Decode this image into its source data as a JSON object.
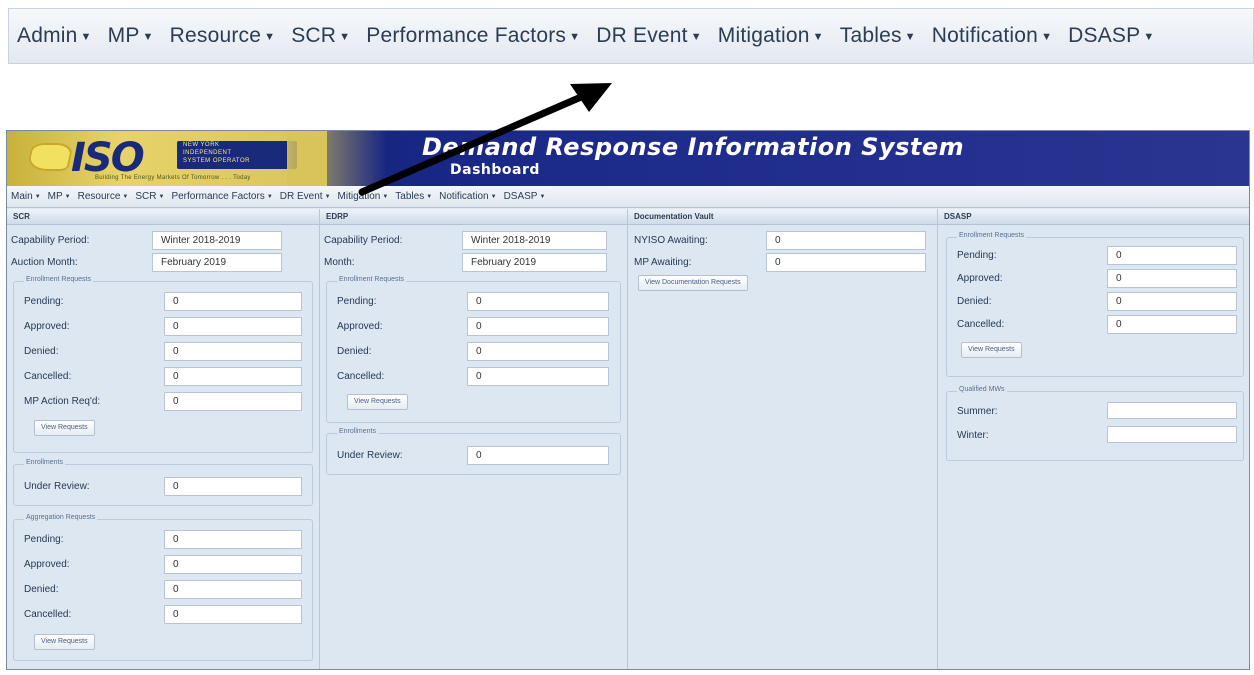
{
  "zoomed_menu": [
    {
      "label": "Admin"
    },
    {
      "label": "MP"
    },
    {
      "label": "Resource"
    },
    {
      "label": "SCR"
    },
    {
      "label": "Performance Factors"
    },
    {
      "label": "DR Event"
    },
    {
      "label": "Mitigation"
    },
    {
      "label": "Tables"
    },
    {
      "label": "Notification"
    },
    {
      "label": "DSASP"
    }
  ],
  "window": {
    "title": "Demand Response Information System",
    "subtitle": "Dashboard",
    "logo": {
      "text": "ISO",
      "org_lines": [
        "NEW YORK",
        "INDEPENDENT",
        "SYSTEM OPERATOR"
      ],
      "tagline": "Building The Energy Markets Of Tomorrow . . . Today"
    }
  },
  "menu": [
    {
      "label": "Main"
    },
    {
      "label": "MP"
    },
    {
      "label": "Resource"
    },
    {
      "label": "SCR"
    },
    {
      "label": "Performance Factors"
    },
    {
      "label": "DR Event"
    },
    {
      "label": "Mitigation"
    },
    {
      "label": "Tables"
    },
    {
      "label": "Notification"
    },
    {
      "label": "DSASP"
    }
  ],
  "scr": {
    "header": "SCR",
    "capability_label": "Capability Period:",
    "capability_value": "Winter 2018-2019",
    "auction_label": "Auction Month:",
    "auction_value": "February 2019",
    "enrollment_requests": {
      "legend": "Enrollment Requests",
      "rows": [
        {
          "label": "Pending:",
          "value": "0"
        },
        {
          "label": "Approved:",
          "value": "0"
        },
        {
          "label": "Denied:",
          "value": "0"
        },
        {
          "label": "Cancelled:",
          "value": "0"
        },
        {
          "label": "MP Action Req'd:",
          "value": "0"
        }
      ],
      "button": "View Requests"
    },
    "enrollments": {
      "legend": "Enrollments",
      "label": "Under Review:",
      "value": "0"
    },
    "aggregation_requests": {
      "legend": "Aggregation Requests",
      "rows": [
        {
          "label": "Pending:",
          "value": "0"
        },
        {
          "label": "Approved:",
          "value": "0"
        },
        {
          "label": "Denied:",
          "value": "0"
        },
        {
          "label": "Cancelled:",
          "value": "0"
        }
      ],
      "button": "View Requests"
    }
  },
  "edrp": {
    "header": "EDRP",
    "capability_label": "Capability Period:",
    "capability_value": "Winter 2018-2019",
    "month_label": "Month:",
    "month_value": "February 2019",
    "enrollment_requests": {
      "legend": "Enrollment Requests",
      "rows": [
        {
          "label": "Pending:",
          "value": "0"
        },
        {
          "label": "Approved:",
          "value": "0"
        },
        {
          "label": "Denied:",
          "value": "0"
        },
        {
          "label": "Cancelled:",
          "value": "0"
        }
      ],
      "button": "View Requests"
    },
    "enrollments": {
      "legend": "Enrollments",
      "label": "Under Review:",
      "value": "0"
    }
  },
  "vault": {
    "header": "Documentation Vault",
    "nyiso_label": "NYISO Awaiting:",
    "nyiso_value": "0",
    "mp_label": "MP Awaiting:",
    "mp_value": "0",
    "button": "View Documentation Requests"
  },
  "dsasp": {
    "header": "DSASP",
    "enrollment_requests": {
      "legend": "Enrollment Requests",
      "rows": [
        {
          "label": "Pending:",
          "value": "0"
        },
        {
          "label": "Approved:",
          "value": "0"
        },
        {
          "label": "Denied:",
          "value": "0"
        },
        {
          "label": "Cancelled:",
          "value": "0"
        }
      ],
      "button": "View Requests"
    },
    "qualified": {
      "legend": "Qualified MWs",
      "summer_label": "Summer:",
      "summer_value": "",
      "winter_label": "Winter:",
      "winter_value": ""
    }
  },
  "colors": {
    "banner_blue": "#1c2a8a",
    "logo_gold": "#e8d36a",
    "panel_bg": "#dde7f2",
    "arrow": "#000000"
  }
}
